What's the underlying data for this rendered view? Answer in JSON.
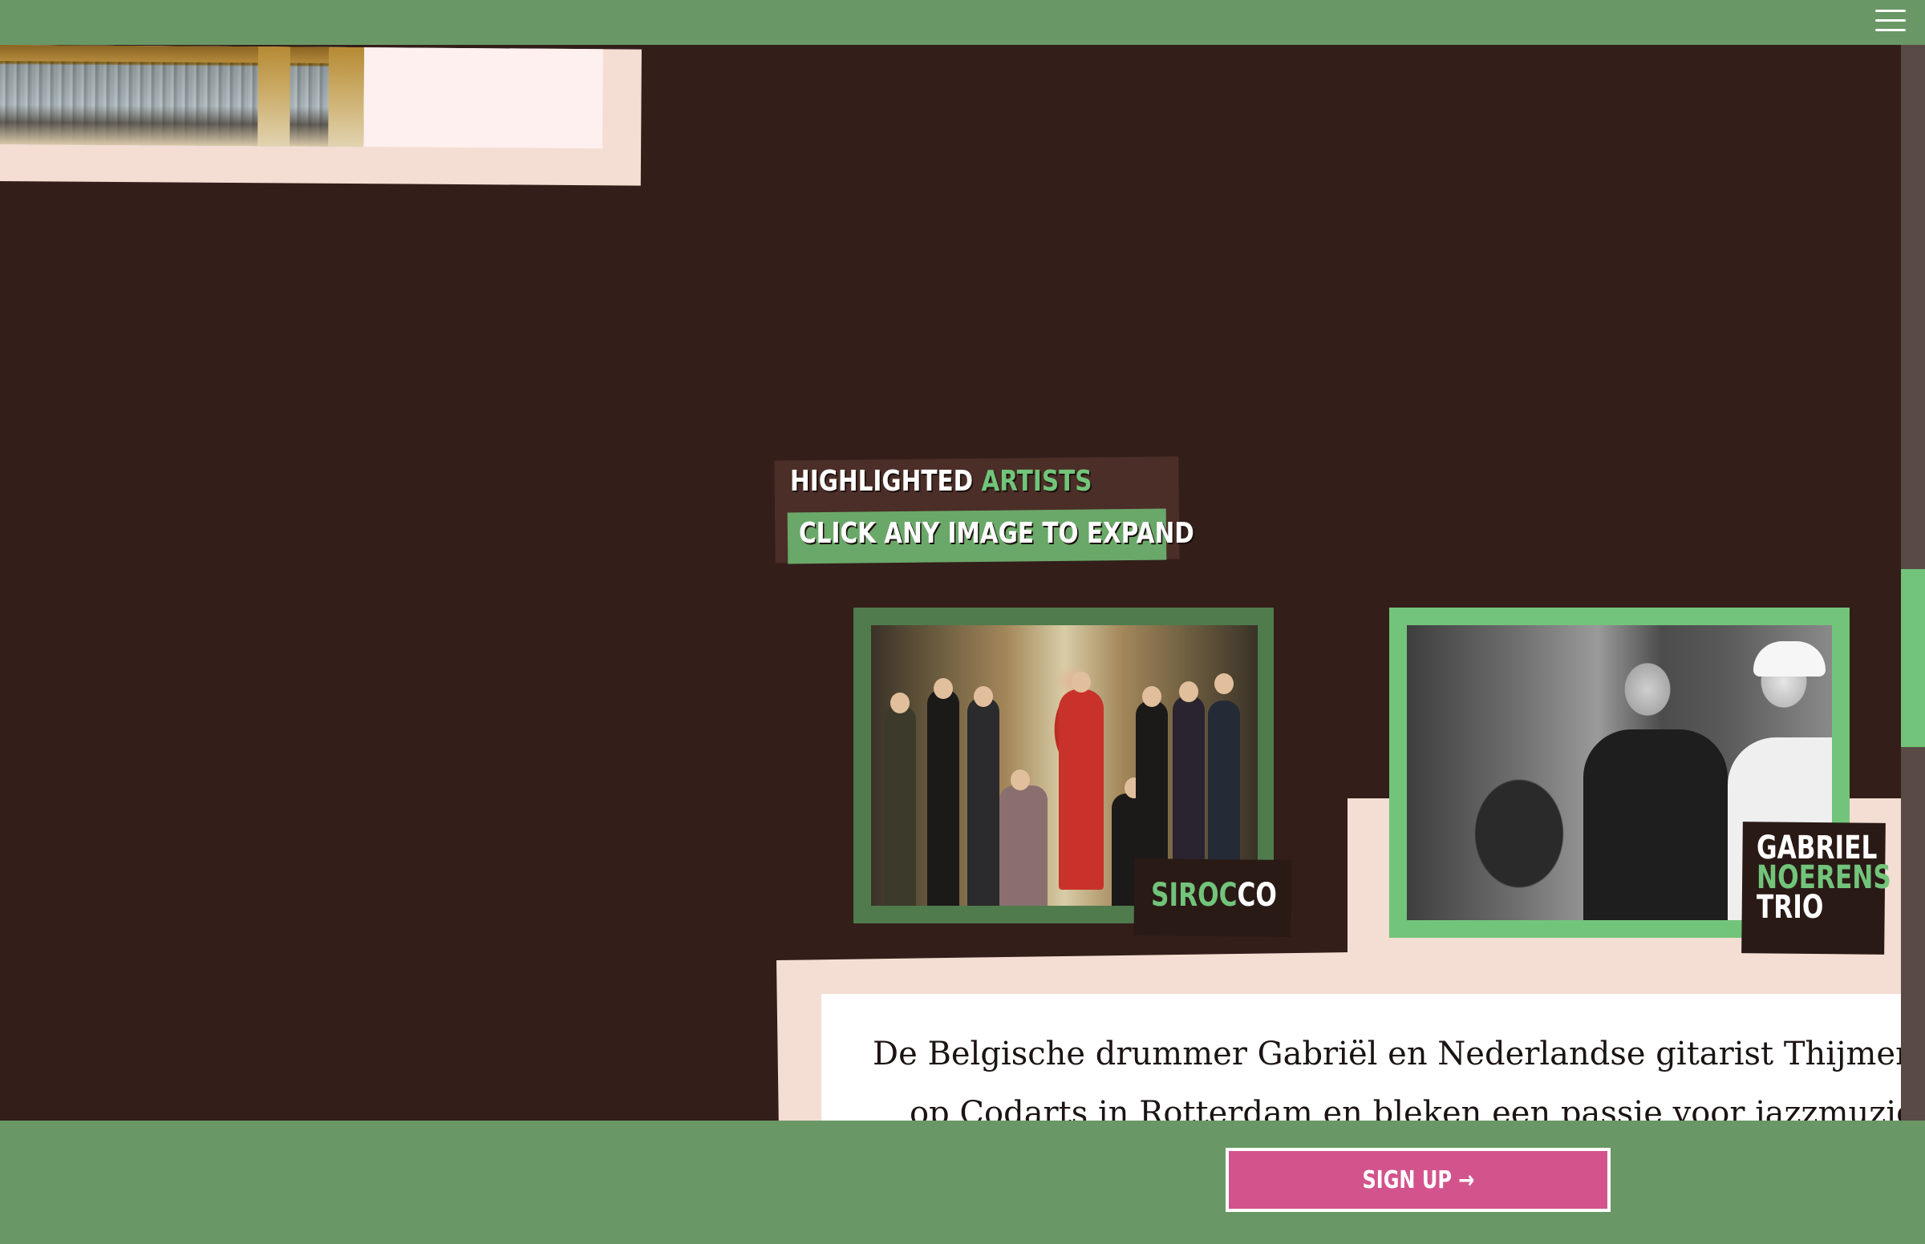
{
  "header": {
    "menu_icon": "hamburger-menu-icon"
  },
  "highlighted": {
    "title_main": "HIGHLIGHTED",
    "title_accent": "ARTISTS",
    "subtitle": "CLICK ANY IMAGE TO EXPAND"
  },
  "artists": [
    {
      "name_accent": "SIROC",
      "name_rest": "CO"
    },
    {
      "line1": "GABRIEL",
      "line2": "NOERENS",
      "line3": "TRIO"
    }
  ],
  "description": {
    "line1": "De Belgische drummer Gabriël en Nederlandse gitarist Thijmen e",
    "line2": "op Codarts in Rotterdam en bleken een passie voor jazzmuziek"
  },
  "footer": {
    "signup_label": "SIGN UP",
    "signup_arrow": "→"
  },
  "colors": {
    "background": "#331e1a",
    "bar_green": "#6a9766",
    "accent_green": "#72c47a",
    "pink_card": "#f4ddd2",
    "signup_pink": "#d3548d"
  }
}
